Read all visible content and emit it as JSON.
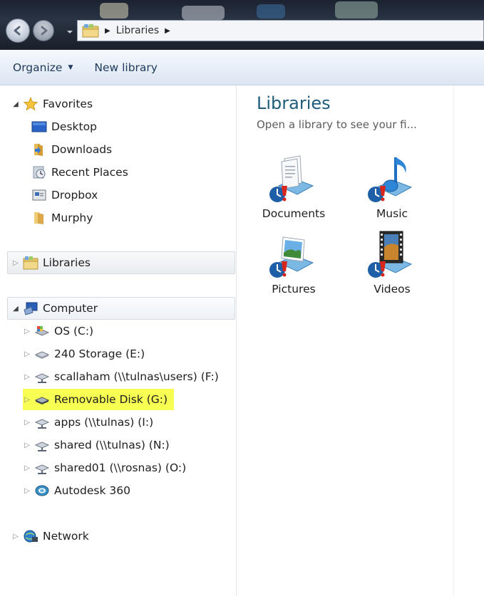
{
  "address_bar": {
    "crumbs": [
      "Libraries"
    ]
  },
  "command_bar": {
    "organize_label": "Organize",
    "new_library_label": "New library"
  },
  "navigation": {
    "favorites": {
      "label": "Favorites",
      "items": [
        {
          "label": "Desktop",
          "icon": "desktop-icon"
        },
        {
          "label": "Downloads",
          "icon": "downloads-folder-icon"
        },
        {
          "label": "Recent Places",
          "icon": "recent-places-icon"
        },
        {
          "label": "Dropbox",
          "icon": "dropbox-icon"
        },
        {
          "label": "Murphy",
          "icon": "folder-icon"
        }
      ]
    },
    "libraries": {
      "label": "Libraries"
    },
    "computer": {
      "label": "Computer",
      "items": [
        {
          "label": "OS (C:)",
          "icon": "os-drive-icon"
        },
        {
          "label": "240 Storage (E:)",
          "icon": "hard-drive-icon"
        },
        {
          "label": "scallaham (\\\\tulnas\\users) (F:)",
          "icon": "network-drive-icon"
        },
        {
          "label": "Removable Disk (G:)",
          "icon": "removable-disk-icon",
          "highlighted": true
        },
        {
          "label": "apps (\\\\tulnas) (I:)",
          "icon": "network-drive-icon"
        },
        {
          "label": "shared (\\\\tulnas) (N:)",
          "icon": "network-drive-icon"
        },
        {
          "label": "shared01 (\\\\rosnas) (O:)",
          "icon": "network-drive-icon"
        },
        {
          "label": "Autodesk 360",
          "icon": "autodesk-360-icon"
        }
      ]
    },
    "network": {
      "label": "Network"
    }
  },
  "content": {
    "title": "Libraries",
    "subtitle": "Open a library to see your fi...",
    "libraries": [
      {
        "label": "Documents",
        "icon": "documents-library-icon"
      },
      {
        "label": "Music",
        "icon": "music-library-icon"
      },
      {
        "label": "Pictures",
        "icon": "pictures-library-icon"
      },
      {
        "label": "Videos",
        "icon": "videos-library-icon"
      }
    ]
  },
  "colors": {
    "highlight": "#f6ff52",
    "title_blue": "#1e5c7a",
    "command_text": "#1e395b"
  }
}
